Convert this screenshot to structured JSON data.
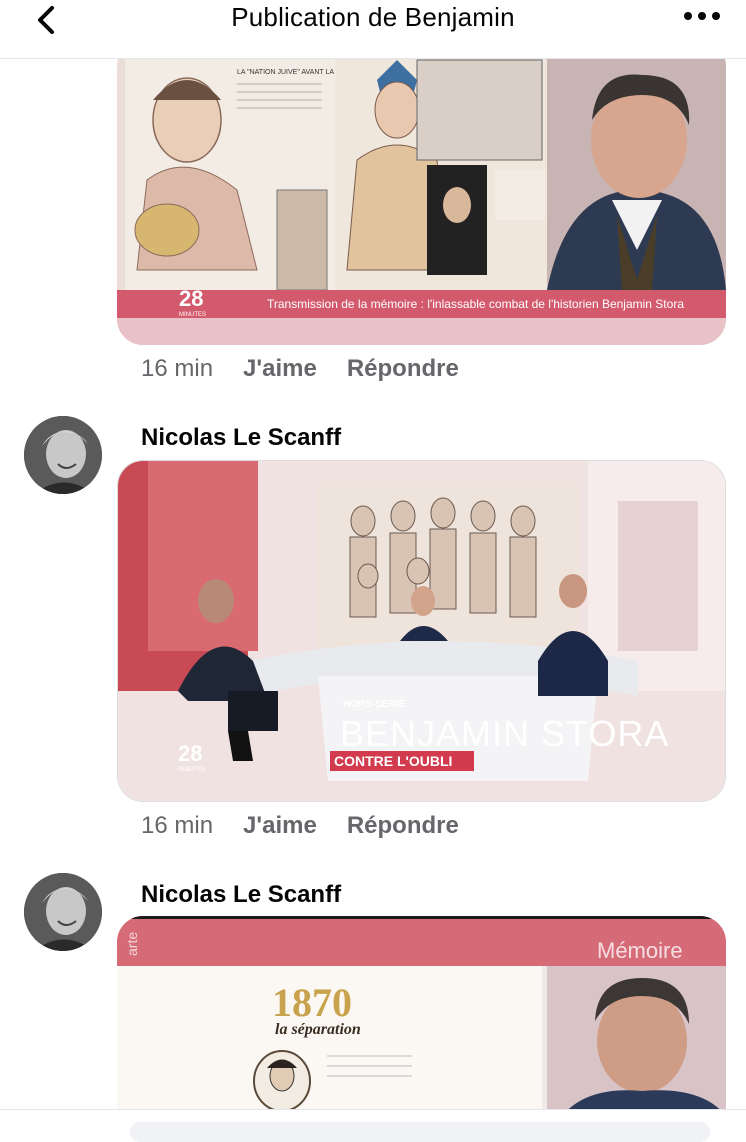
{
  "header": {
    "title": "Publication de Benjamin",
    "back_icon": "chevron-left-icon",
    "more_icon": "more-horizontal-icon"
  },
  "comments": [
    {
      "author": "",
      "media": {
        "caption": "Transmission de la mémoire : l'inlassable combat de l'historien Benjamin Stora",
        "logo": "28",
        "logo_sub": "MINUTES",
        "inset_text": "LA \"NATION JUIVE\" AVANT LA CONQUÊTE FRANÇAISE"
      },
      "time": "16 min",
      "like_label": "J'aime",
      "reply_label": "Répondre"
    },
    {
      "author": "Nicolas Le Scanff",
      "media": {
        "kicker": "HORS-SÉRIE",
        "headline": "BENJAMIN STORA",
        "tag": "CONTRE L'OUBLI",
        "logo": "28",
        "logo_sub": "MINUTES"
      },
      "time": "16 min",
      "like_label": "J'aime",
      "reply_label": "Répondre"
    },
    {
      "author": "Nicolas Le Scanff",
      "media": {
        "corner_text": "Mémoire",
        "year": "1870",
        "subtitle": "la séparation",
        "side_text": "arte"
      }
    }
  ],
  "colors": {
    "brand_red": "#d23a4e",
    "muted_text": "#65676b",
    "studio_pink": "#e8c8c8"
  }
}
